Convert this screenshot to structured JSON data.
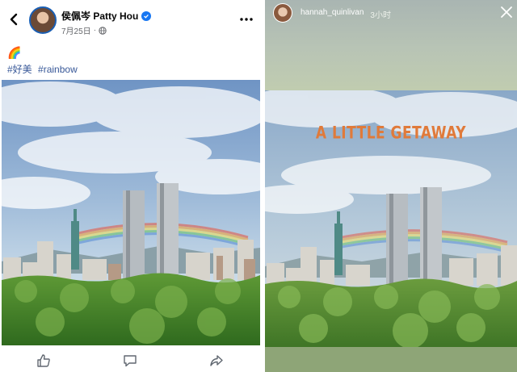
{
  "post": {
    "author_name": "侯佩岑 Patty Hou",
    "date": "7月25日",
    "dot": "·",
    "emoji": "🌈",
    "hashtags": [
      "#好美",
      "#rainbow"
    ]
  },
  "story": {
    "username": "hannah_quinlivan",
    "time_ago": "3小时",
    "overlay_text": "A LITTLE GETAWAY"
  },
  "colors": {
    "link": "#385898",
    "verified_badge": "#1877f2",
    "story_overlay_text": "#e07a3a"
  },
  "icons": {
    "back": "chevron-left-icon",
    "verified": "verified-badge-icon",
    "audience": "globe-icon",
    "more": "more-dots-icon",
    "like": "thumbs-up-icon",
    "comment": "comment-icon",
    "share": "share-icon",
    "close": "close-icon"
  }
}
